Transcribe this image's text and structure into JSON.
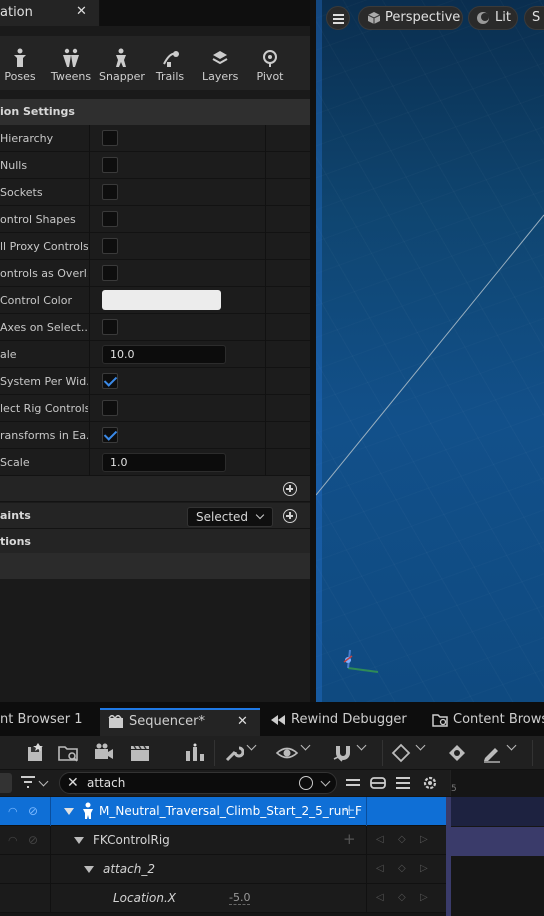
{
  "details_panel": {
    "tab_title": "ation",
    "tools": [
      {
        "label": "Poses",
        "icon": "poses-icon"
      },
      {
        "label": "Tweens",
        "icon": "tweens-icon"
      },
      {
        "label": "Snapper",
        "icon": "snapper-icon"
      },
      {
        "label": "Trails",
        "icon": "trails-icon"
      },
      {
        "label": "Layers",
        "icon": "layers-icon"
      },
      {
        "label": "Pivot",
        "icon": "pivot-icon"
      }
    ],
    "section_title": "ion Settings",
    "settings": [
      {
        "label": "Hierarchy",
        "kind": "checkbox",
        "checked": false
      },
      {
        "label": "Nulls",
        "kind": "checkbox",
        "checked": false
      },
      {
        "label": "Sockets",
        "kind": "checkbox",
        "checked": false
      },
      {
        "label": "ontrol Shapes",
        "kind": "checkbox",
        "checked": false
      },
      {
        "label": "ll Proxy Controls",
        "kind": "checkbox",
        "checked": false
      },
      {
        "label": "ontrols as Overl...",
        "kind": "checkbox",
        "checked": false
      },
      {
        "label": "Control Color",
        "kind": "color",
        "value": "#ececec"
      },
      {
        "label": "Axes on Select...",
        "kind": "checkbox",
        "checked": false
      },
      {
        "label": "ale",
        "kind": "number",
        "value": "10.0"
      },
      {
        "label": "System Per Wid...",
        "kind": "checkbox",
        "checked": true
      },
      {
        "label": "lect Rig Controls",
        "kind": "checkbox",
        "checked": false
      },
      {
        "label": "ransforms in Ea...",
        "kind": "checkbox",
        "checked": true
      },
      {
        "label": "Scale",
        "kind": "number",
        "value": "1.0"
      }
    ],
    "group_rows": {
      "first": "",
      "constraints_label": "aints",
      "constraints_dropdown": "Selected",
      "options_label": "tions"
    }
  },
  "viewport": {
    "menu_icon": "hamburger-icon",
    "perspective_label": "Perspective",
    "lit_label": "Lit",
    "show_label": "S"
  },
  "bottom_tabs": {
    "content_browser_1": "nt Browser 1",
    "sequencer": "Sequencer*",
    "rewind_debugger": "Rewind Debugger",
    "content_browser": "Content Browse"
  },
  "filter": {
    "search_value": "attach",
    "timeline_number": "5"
  },
  "tracks": [
    {
      "label": "M_Neutral_Traversal_Climb_Start_2_5_run_F",
      "selected": true
    },
    {
      "label": "FKControlRig"
    },
    {
      "label": "attach_2"
    },
    {
      "label": "Location.X",
      "value": "-5.0"
    }
  ],
  "colors": {
    "accent": "#1f79e5",
    "selected_track": "#0f6fd6",
    "viewport_sky": "#12508a"
  }
}
